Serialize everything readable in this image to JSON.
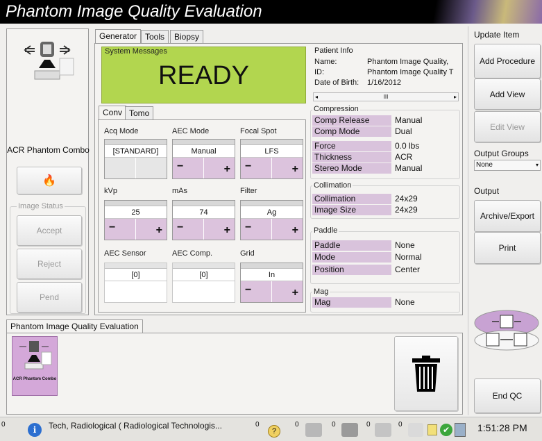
{
  "app": {
    "title": "Phantom Image Quality Evaluation"
  },
  "left": {
    "procedure_name": "ACR Phantom Combo",
    "image_status_label": "Image Status",
    "accept": "Accept",
    "reject": "Reject",
    "pend": "Pend"
  },
  "tabs": {
    "generator": "Generator",
    "tools": "Tools",
    "biopsy": "Biopsy"
  },
  "system": {
    "label": "System Messages",
    "status": "READY",
    "status_color": "#b2d64f"
  },
  "patient": {
    "header": "Patient Info",
    "name_label": "Name:",
    "name_value": "Phantom Image Quality,",
    "id_label": "ID:",
    "id_value": "Phantom Image Quality T",
    "dob_label": "Date of Birth:",
    "dob_value": "1/16/2012",
    "scroll_mid": "III"
  },
  "subtabs": {
    "conv": "Conv",
    "tomo": "Tomo"
  },
  "controls": {
    "acq_mode": {
      "label": "Acq Mode",
      "value": "[STANDARD]"
    },
    "aec_mode": {
      "label": "AEC Mode",
      "value": "Manual"
    },
    "focal_spot": {
      "label": "Focal Spot",
      "value": "LFS"
    },
    "kvp": {
      "label": "kVp",
      "value": "25"
    },
    "mas": {
      "label": "mAs",
      "value": "74"
    },
    "filter": {
      "label": "Filter",
      "value": "Ag"
    },
    "aec_sensor": {
      "label": "AEC Sensor",
      "value": "[0]"
    },
    "aec_comp": {
      "label": "AEC Comp.",
      "value": "[0]"
    },
    "grid": {
      "label": "Grid",
      "value": "In"
    },
    "minus": "−",
    "plus": "+"
  },
  "compression": {
    "header": "Compression",
    "rows": [
      {
        "label": "Comp Release",
        "value": "Manual"
      },
      {
        "label": "Comp Mode",
        "value": "Dual"
      },
      {
        "label": "Force",
        "value": "0.0 lbs"
      },
      {
        "label": "Thickness",
        "value": "ACR"
      },
      {
        "label": "Stereo Mode",
        "value": "Manual"
      }
    ]
  },
  "collimation": {
    "header": "Collimation",
    "rows": [
      {
        "label": "Collimation",
        "value": "24x29"
      },
      {
        "label": "Image Size",
        "value": "24x29"
      }
    ]
  },
  "paddle": {
    "header": "Paddle",
    "rows": [
      {
        "label": "Paddle",
        "value": "None"
      },
      {
        "label": "Mode",
        "value": "Normal"
      },
      {
        "label": "Position",
        "value": "Center"
      }
    ]
  },
  "mag": {
    "header": "Mag",
    "rows": [
      {
        "label": "Mag",
        "value": "None"
      }
    ]
  },
  "right": {
    "update_item": "Update Item",
    "add_procedure": "Add Procedure",
    "add_view": "Add View",
    "edit_view": "Edit View",
    "output_groups": "Output Groups",
    "output_group_value": "None",
    "output": "Output",
    "archive": "Archive/Export",
    "print": "Print",
    "end_qc": "End QC"
  },
  "bottom": {
    "tab": "Phantom Image Quality Evaluation",
    "thumb_label": "ACR Phantom Combo"
  },
  "taskbar": {
    "left_count": "0",
    "user": "Tech, Radiological ( Radiological Technologis...",
    "counts": [
      "0",
      "0",
      "0",
      "0",
      "0"
    ],
    "time": "1:51:28 PM"
  }
}
